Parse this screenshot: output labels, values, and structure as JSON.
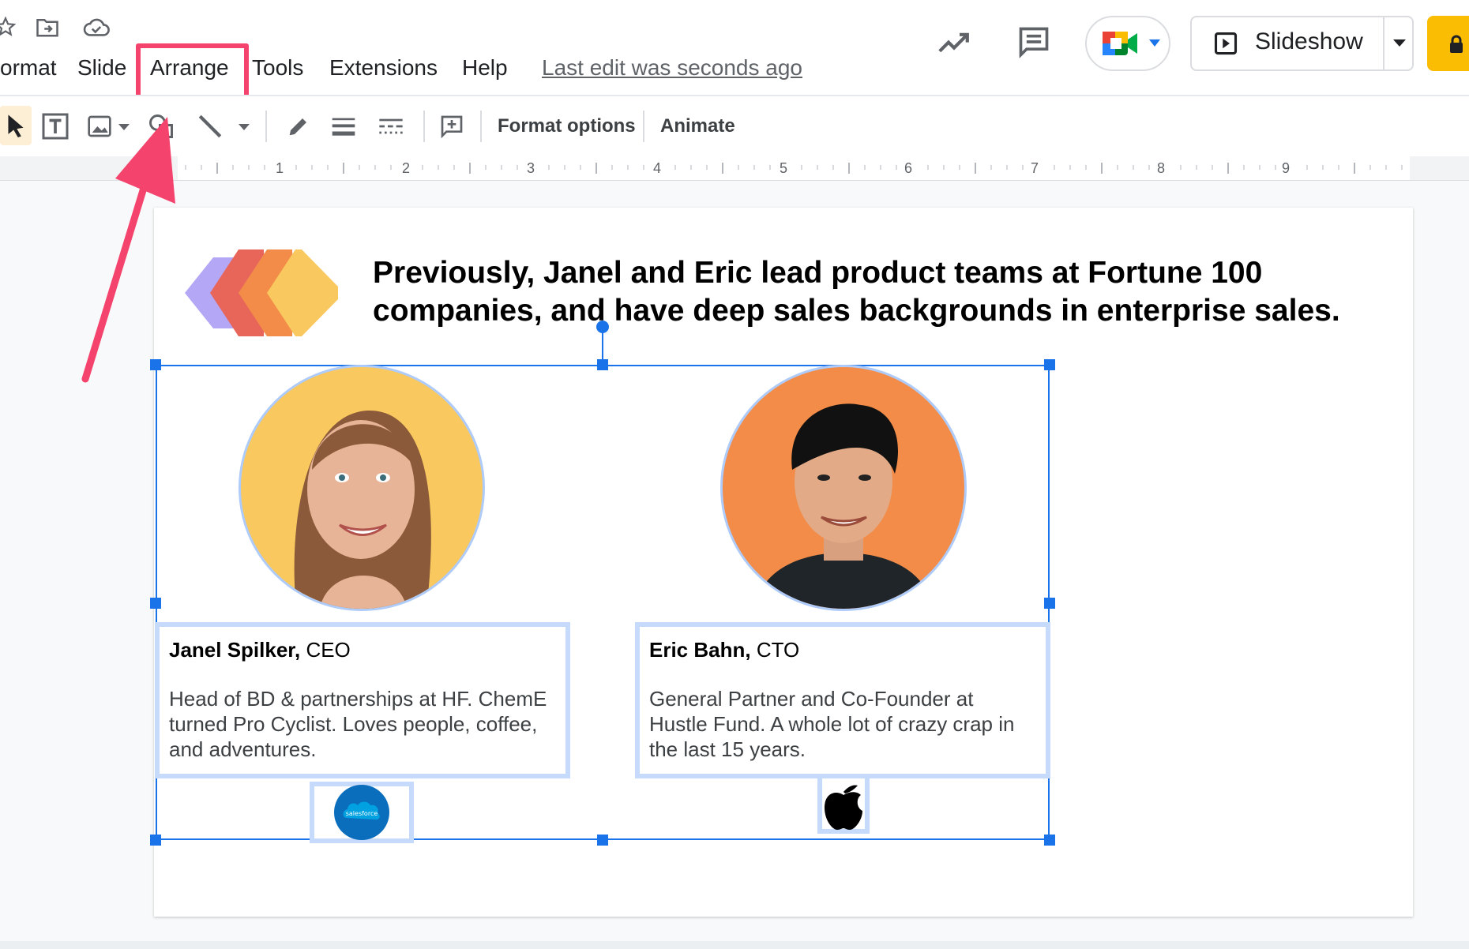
{
  "menu": {
    "items": [
      {
        "id": "format",
        "label": "ormat"
      },
      {
        "id": "slide",
        "label": "Slide"
      },
      {
        "id": "arrange",
        "label": "Arrange"
      },
      {
        "id": "tools",
        "label": "Tools"
      },
      {
        "id": "extensions",
        "label": "Extensions"
      },
      {
        "id": "help",
        "label": "Help"
      }
    ],
    "last_edit": "Last edit was seconds ago",
    "highlighted": "Arrange"
  },
  "header": {
    "slideshow_label": "Slideshow",
    "icons": [
      "star-icon",
      "move-to-folder-icon",
      "cloud-saved-icon",
      "activity-trend-icon",
      "comments-icon",
      "google-meet-icon",
      "present-icon",
      "dropdown-caret-icon",
      "lock-icon"
    ]
  },
  "toolbar": {
    "format_options": "Format options",
    "animate": "Animate",
    "tools": [
      "select-cursor-icon",
      "text-box-icon",
      "insert-image-icon",
      "shape-icon",
      "line-icon",
      "pen-color-icon",
      "line-weight-icon",
      "line-dash-icon",
      "add-comment-icon"
    ]
  },
  "ruler": {
    "numbers": [
      "1",
      "2",
      "3",
      "4",
      "5",
      "6",
      "7",
      "8",
      "9"
    ]
  },
  "slide": {
    "headline_line1": "Previously, Janel and Eric lead product teams at Fortune 100",
    "headline_line2": "companies, and have deep sales backgrounds in enterprise sales.",
    "people": [
      {
        "name": "Janel Spilker,",
        "role": " CEO",
        "bio": "Head of BD & partnerships at HF. ChemE turned Pro Cyclist. Loves people, coffee, and adventures.",
        "photo_bg": "#f9c85f",
        "logo": "salesforce"
      },
      {
        "name": "Eric Bahn,",
        "role": " CTO",
        "bio": "General Partner and Co-Founder at Hustle Fund. A whole lot of crazy crap in the last 15 years.",
        "photo_bg": "#f28c48",
        "logo": "apple-logo"
      }
    ]
  },
  "colors": {
    "accent_blue": "#1a73e8",
    "highlight_pink": "#f4436c",
    "share_yellow": "#fbbc04",
    "chevron_purple": "#b4a7f5",
    "chevron_red": "#e8655a",
    "chevron_orange": "#f28c48",
    "chevron_yellow": "#f9c85f"
  }
}
